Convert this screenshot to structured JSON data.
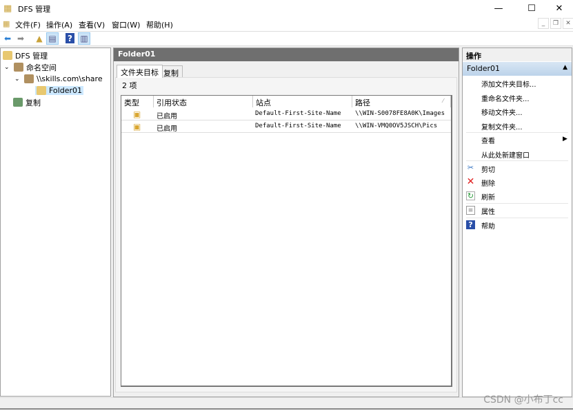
{
  "window": {
    "title": "DFS 管理",
    "minimize": "—",
    "maximize": "☐",
    "close": "✕"
  },
  "menu": [
    "文件(F)",
    "操作(A)",
    "查看(V)",
    "窗口(W)",
    "帮助(H)"
  ],
  "mdi": {
    "minimize": "_",
    "restore": "❐",
    "close": "✕"
  },
  "tree": {
    "root": "DFS 管理",
    "namespaces": "命名空间",
    "namespace": "\\\\skills.com\\share",
    "folder": "Folder01",
    "replication": "复制"
  },
  "center": {
    "header": "Folder01",
    "tabs": [
      "文件夹目标",
      "复制"
    ],
    "count": "2 项",
    "columns": [
      "类型",
      "引用状态",
      "站点",
      "路径"
    ],
    "rows": [
      {
        "status": "已启用",
        "site": "Default-First-Site-Name",
        "path": "\\\\WIN-S0078FE8A0K\\Images"
      },
      {
        "status": "已启用",
        "site": "Default-First-Site-Name",
        "path": "\\\\WIN-VMQ0OV5JSCH\\Pics"
      }
    ]
  },
  "actions": {
    "header": "操作",
    "selected": "Folder01",
    "items": [
      "添加文件夹目标...",
      "重命名文件夹...",
      "移动文件夹...",
      "复制文件夹...",
      "查看",
      "从此处新建窗口",
      "剪切",
      "删除",
      "刷新",
      "属性",
      "帮助"
    ]
  },
  "colors": {
    "selection": "#cce8ff",
    "header": "#6f6f6f",
    "delete": "#e02020"
  },
  "watermark": "CSDN @小布丁cc"
}
